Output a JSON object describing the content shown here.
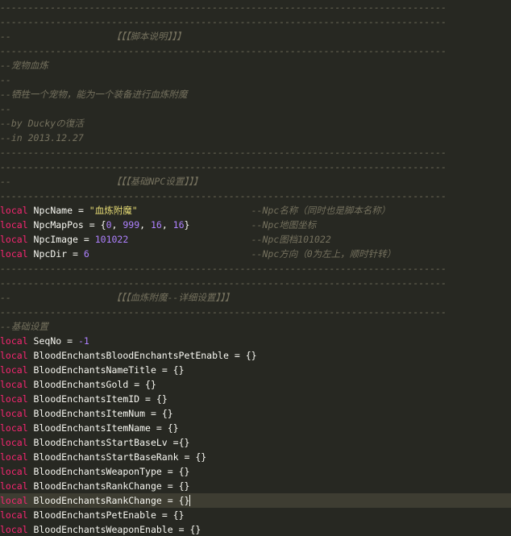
{
  "theme": {
    "background": "#272822",
    "current_line": "#3e3d32",
    "comment": "#75715e",
    "keyword": "#f92672",
    "number": "#ae81ff",
    "string": "#e6db74",
    "text": "#f8f8f2"
  },
  "lines": [
    [
      {
        "t": "comment",
        "v": "--------------------------------------------------------------------------------"
      }
    ],
    [
      {
        "t": "comment",
        "v": "--------------------------------------------------------------------------------"
      }
    ],
    [
      {
        "t": "comment",
        "v": "--"
      },
      {
        "t": "comment",
        "v": "【【【脚本说明】】】",
        "col": 20
      }
    ],
    [
      {
        "t": "comment",
        "v": "--------------------------------------------------------------------------------"
      }
    ],
    [
      {
        "t": "comment",
        "v": "--宠物血炼"
      }
    ],
    [
      {
        "t": "comment",
        "v": "--"
      }
    ],
    [
      {
        "t": "comment",
        "v": "--牺牲一个宠物，能为一个装备进行血炼附魔"
      }
    ],
    [
      {
        "t": "comment",
        "v": "--"
      }
    ],
    [
      {
        "t": "comment",
        "v": "--by Duckyの復活"
      }
    ],
    [
      {
        "t": "comment",
        "v": "--in 2013.12.27"
      }
    ],
    [
      {
        "t": "comment",
        "v": "--------------------------------------------------------------------------------"
      }
    ],
    [
      {
        "t": "comment",
        "v": "--------------------------------------------------------------------------------"
      }
    ],
    [
      {
        "t": "comment",
        "v": "--"
      },
      {
        "t": "comment",
        "v": "【【【基础NPC设置】】】",
        "col": 20
      }
    ],
    [
      {
        "t": "comment",
        "v": "--------------------------------------------------------------------------------"
      }
    ],
    [
      {
        "t": "kw",
        "v": "local"
      },
      {
        "t": "id",
        "v": " NpcName "
      },
      {
        "t": "op",
        "v": "="
      },
      {
        "t": "id",
        "v": " "
      },
      {
        "t": "str",
        "v": "\"血炼附魔\""
      },
      {
        "t": "comment",
        "v": "--Npc名称（同时也是脚本名称）",
        "col": 45
      }
    ],
    [
      {
        "t": "kw",
        "v": "local"
      },
      {
        "t": "id",
        "v": " NpcMapPos "
      },
      {
        "t": "op",
        "v": "="
      },
      {
        "t": "punc",
        "v": " {"
      },
      {
        "t": "num",
        "v": "0"
      },
      {
        "t": "punc",
        "v": ", "
      },
      {
        "t": "num",
        "v": "999"
      },
      {
        "t": "punc",
        "v": ", "
      },
      {
        "t": "num",
        "v": "16"
      },
      {
        "t": "punc",
        "v": ", "
      },
      {
        "t": "num",
        "v": "16"
      },
      {
        "t": "punc",
        "v": "}"
      },
      {
        "t": "comment",
        "v": "--Npc地图坐标",
        "col": 45
      }
    ],
    [
      {
        "t": "kw",
        "v": "local"
      },
      {
        "t": "id",
        "v": " NpcImage "
      },
      {
        "t": "op",
        "v": "="
      },
      {
        "t": "id",
        "v": " "
      },
      {
        "t": "num",
        "v": "101022"
      },
      {
        "t": "comment",
        "v": "--Npc图档101022",
        "col": 45
      }
    ],
    [
      {
        "t": "kw",
        "v": "local"
      },
      {
        "t": "id",
        "v": " NpcDir "
      },
      {
        "t": "op",
        "v": "="
      },
      {
        "t": "id",
        "v": " "
      },
      {
        "t": "num",
        "v": "6"
      },
      {
        "t": "comment",
        "v": "--Npc方向（0为左上，顺时针转）",
        "col": 45
      }
    ],
    [
      {
        "t": "comment",
        "v": "--------------------------------------------------------------------------------"
      }
    ],
    [
      {
        "t": "comment",
        "v": "--------------------------------------------------------------------------------"
      }
    ],
    [
      {
        "t": "comment",
        "v": "--"
      },
      {
        "t": "comment",
        "v": "【【【血炼附魔--详细设置】】】",
        "col": 20
      }
    ],
    [
      {
        "t": "comment",
        "v": "--------------------------------------------------------------------------------"
      }
    ],
    [
      {
        "t": "comment",
        "v": "--基础设置"
      }
    ],
    [
      {
        "t": "kw",
        "v": "local"
      },
      {
        "t": "id",
        "v": " SeqNo "
      },
      {
        "t": "op",
        "v": "="
      },
      {
        "t": "id",
        "v": " "
      },
      {
        "t": "num",
        "v": "-1"
      }
    ],
    [
      {
        "t": "kw",
        "v": "local"
      },
      {
        "t": "id",
        "v": " BloodEnchantsBloodEnchantsPetEnable "
      },
      {
        "t": "op",
        "v": "="
      },
      {
        "t": "punc",
        "v": " {}"
      }
    ],
    [
      {
        "t": "kw",
        "v": "local"
      },
      {
        "t": "id",
        "v": " BloodEnchantsNameTitle "
      },
      {
        "t": "op",
        "v": "="
      },
      {
        "t": "punc",
        "v": " {}"
      }
    ],
    [
      {
        "t": "kw",
        "v": "local"
      },
      {
        "t": "id",
        "v": " BloodEnchantsGold "
      },
      {
        "t": "op",
        "v": "="
      },
      {
        "t": "punc",
        "v": " {}"
      }
    ],
    [
      {
        "t": "kw",
        "v": "local"
      },
      {
        "t": "id",
        "v": " BloodEnchantsItemID "
      },
      {
        "t": "op",
        "v": "="
      },
      {
        "t": "punc",
        "v": " {}"
      }
    ],
    [
      {
        "t": "kw",
        "v": "local"
      },
      {
        "t": "id",
        "v": " BloodEnchantsItemNum "
      },
      {
        "t": "op",
        "v": "="
      },
      {
        "t": "punc",
        "v": " {}"
      }
    ],
    [
      {
        "t": "kw",
        "v": "local"
      },
      {
        "t": "id",
        "v": " BloodEnchantsItemName "
      },
      {
        "t": "op",
        "v": "="
      },
      {
        "t": "punc",
        "v": " {}"
      }
    ],
    [
      {
        "t": "kw",
        "v": "local"
      },
      {
        "t": "id",
        "v": " BloodEnchantsStartBaseLv "
      },
      {
        "t": "op",
        "v": "="
      },
      {
        "t": "punc",
        "v": "{}"
      }
    ],
    [
      {
        "t": "kw",
        "v": "local"
      },
      {
        "t": "id",
        "v": " BloodEnchantsStartBaseRank "
      },
      {
        "t": "op",
        "v": "="
      },
      {
        "t": "punc",
        "v": " {}"
      }
    ],
    [
      {
        "t": "kw",
        "v": "local"
      },
      {
        "t": "id",
        "v": " BloodEnchantsWeaponType "
      },
      {
        "t": "op",
        "v": "="
      },
      {
        "t": "punc",
        "v": " {}"
      }
    ],
    [
      {
        "t": "kw",
        "v": "local"
      },
      {
        "t": "id",
        "v": " BloodEnchantsRankChange "
      },
      {
        "t": "op",
        "v": "="
      },
      {
        "t": "punc",
        "v": " {}"
      }
    ],
    [
      {
        "t": "kw",
        "v": "local"
      },
      {
        "t": "id",
        "v": " BloodEnchantsRankChange "
      },
      {
        "t": "op",
        "v": "="
      },
      {
        "t": "punc",
        "v": " {}"
      }
    ],
    [
      {
        "t": "kw",
        "v": "local"
      },
      {
        "t": "id",
        "v": " BloodEnchantsPetEnable "
      },
      {
        "t": "op",
        "v": "="
      },
      {
        "t": "punc",
        "v": " {}"
      }
    ],
    [
      {
        "t": "kw",
        "v": "local"
      },
      {
        "t": "id",
        "v": " BloodEnchantsWeaponEnable "
      },
      {
        "t": "op",
        "v": "="
      },
      {
        "t": "punc",
        "v": " {}"
      }
    ]
  ],
  "cursor": {
    "line": 34,
    "col": 34
  }
}
